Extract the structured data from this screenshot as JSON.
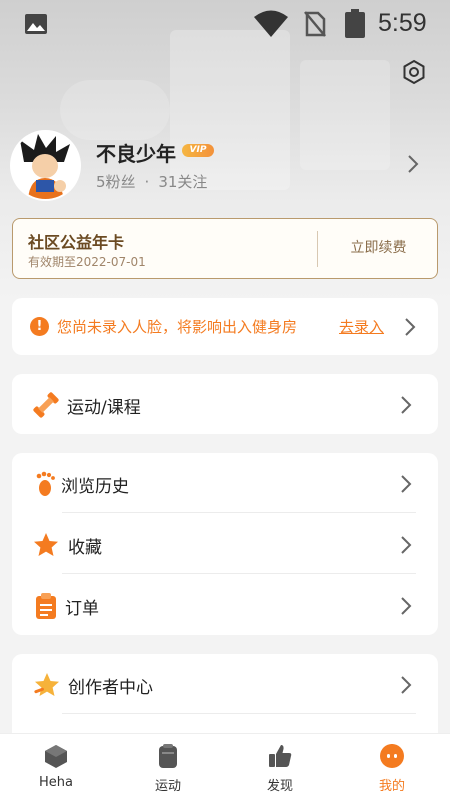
{
  "status_bar": {
    "time": "5:59",
    "icons": [
      "gallery-icon",
      "wifi-icon",
      "no-sim-icon",
      "battery-icon"
    ]
  },
  "profile": {
    "name": "不良少年",
    "vip_label": "VIP",
    "followers": "5粉丝",
    "separator": "·",
    "following": "31关注"
  },
  "card": {
    "title": "社区公益年卡",
    "validity": "有效期至2022-07-01",
    "renew_label": "立即续费"
  },
  "alert": {
    "icon": "!",
    "message": "您尚未录入人脸，将影响出入健身房",
    "action_label": "去录入"
  },
  "menu": {
    "sports": {
      "label": "运动/课程",
      "icon": "dumbbell-icon"
    },
    "history": {
      "label": "浏览历史",
      "icon": "footprint-icon"
    },
    "favorites": {
      "label": "收藏",
      "icon": "star-icon"
    },
    "orders": {
      "label": "订单",
      "icon": "clipboard-icon"
    },
    "creator": {
      "label": "创作者中心",
      "icon": "creator-star-icon"
    }
  },
  "bottom_nav": [
    {
      "label": "Heha",
      "icon": "heha-icon",
      "active": false
    },
    {
      "label": "运动",
      "icon": "sport-icon",
      "active": false
    },
    {
      "label": "发现",
      "icon": "thumb-icon",
      "active": false
    },
    {
      "label": "我的",
      "icon": "me-icon",
      "active": true
    }
  ],
  "colors": {
    "accent": "#f47b20",
    "card_border": "#b99a6d",
    "card_title": "#6b4a22",
    "background": "#f3f3f3"
  }
}
